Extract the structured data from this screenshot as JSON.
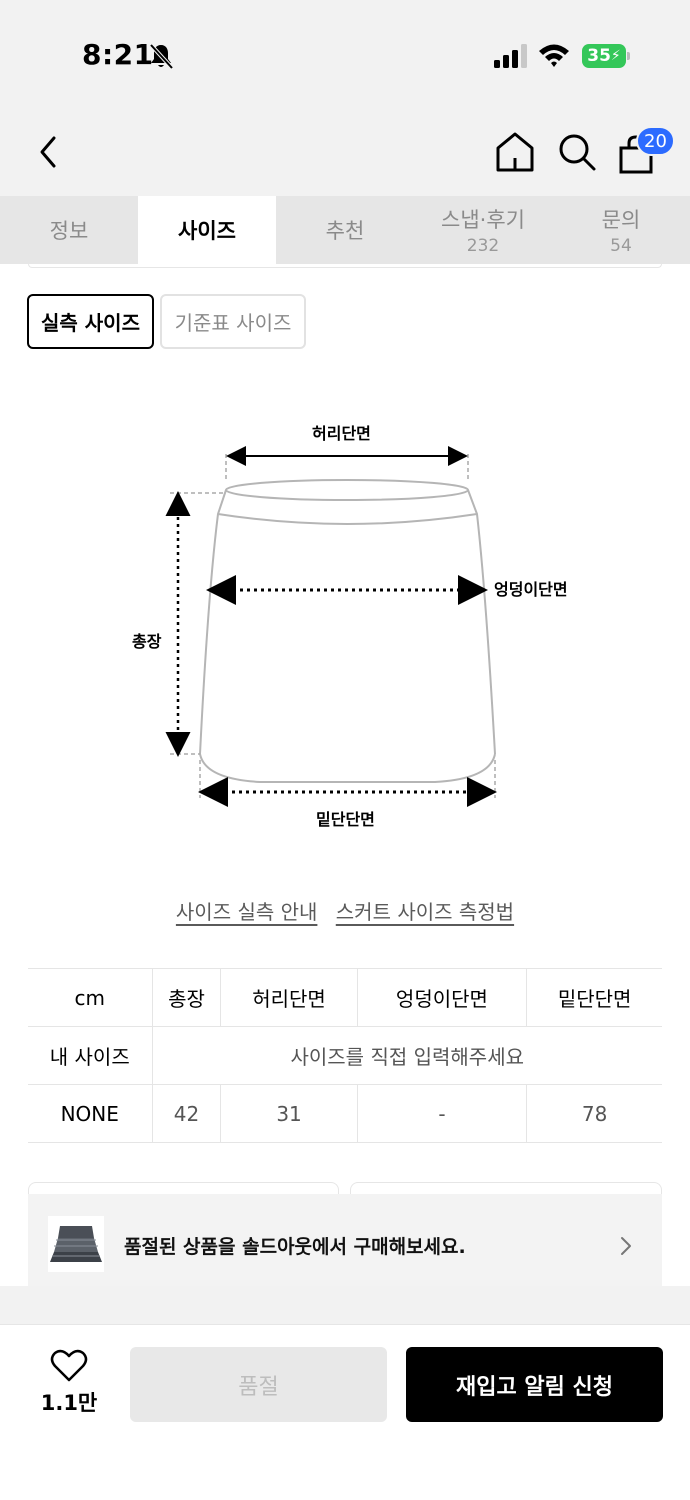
{
  "status_bar": {
    "time": "8:21",
    "battery": "35"
  },
  "header": {
    "cart_count": "20",
    "icons": [
      "chevron-left-icon",
      "home-icon",
      "search-icon",
      "shopping-bag-icon"
    ]
  },
  "tabs": [
    {
      "label": "정보",
      "count": "",
      "active": false
    },
    {
      "label": "사이즈",
      "count": "",
      "active": true
    },
    {
      "label": "추천",
      "count": "",
      "active": false
    },
    {
      "label": "스냅·후기",
      "count": "232",
      "active": false
    },
    {
      "label": "문의",
      "count": "54",
      "active": false
    }
  ],
  "size_toggle": {
    "actual": "실측 사이즈",
    "standard": "기준표 사이즈"
  },
  "diagram": {
    "waist": "허리단면",
    "hip": "엉덩이단면",
    "length": "총장",
    "hem": "밑단단면"
  },
  "guide_links": {
    "measure_guide": "사이즈 실측 안내",
    "skirt_method": "스커트 사이즈 측정법"
  },
  "size_table": {
    "unit": "cm",
    "columns": [
      "총장",
      "허리단면",
      "엉덩이단면",
      "밑단단면"
    ],
    "my_size_label": "내 사이즈",
    "my_size_prompt": "사이즈를 직접 입력해주세요",
    "rows": [
      {
        "name": "NONE",
        "values": [
          "42",
          "31",
          "-",
          "78"
        ]
      }
    ]
  },
  "soldout_banner": {
    "text": "품절된 상품을 솔드아웃에서 구매해보세요."
  },
  "bottom_bar": {
    "likes": "1.1만",
    "soldout_label": "품절",
    "restock_label": "재입고 알림 신청"
  },
  "colors": {
    "accent_badge": "#2c6bff",
    "battery_green": "#34c759",
    "primary_button": "#000000"
  }
}
